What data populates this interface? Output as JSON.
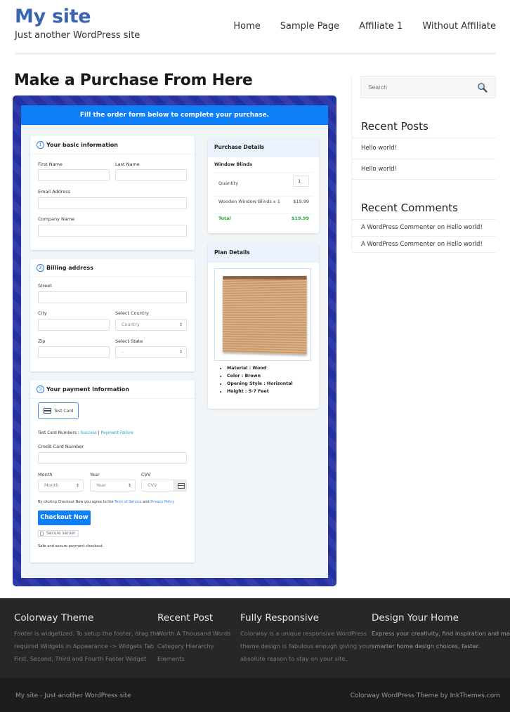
{
  "header": {
    "site_title": "My site",
    "tagline": "Just another WordPress site",
    "nav": [
      "Home",
      "Sample Page",
      "Affiliate 1",
      "Without Affiliate"
    ]
  },
  "page": {
    "title": "Make a Purchase From Here"
  },
  "form": {
    "banner": "Fill the order form below to complete your purchase.",
    "basic": {
      "step": "1",
      "title": "Your basic information",
      "first_name_label": "First Name",
      "last_name_label": "Last Name",
      "email_label": "Email Address",
      "company_label": "Company Name"
    },
    "billing": {
      "step": "2",
      "title": "Billing address",
      "street_label": "Street",
      "city_label": "City",
      "country_label": "Select Country",
      "country_value": "Country",
      "zip_label": "Zip",
      "state_label": "Select State",
      "state_value": "-"
    },
    "payment": {
      "step": "3",
      "title": "Your payment information",
      "method_tab": "Test Card",
      "test_numbers_prefix": "Test Card Numbers : ",
      "success_link": "Success",
      "separator": " | ",
      "failure_link": "Payment Failure",
      "cc_label": "Credit Card Number",
      "month_label": "Month",
      "month_value": "Month",
      "year_label": "Year",
      "year_value": "Year",
      "cvv_label": "CVV",
      "cvv_placeholder": "CVV",
      "agree_prefix": "By clicking Checkout Now you agree to the ",
      "terms_link": "Term of Service",
      "agree_and": " and ",
      "privacy_link": "Privacy Policy",
      "checkout_button": "Checkout Now",
      "secure_badge": "Secure server",
      "secure_note": "Safe and secure payment checkout."
    },
    "purchase": {
      "title": "Purchase Details",
      "product": "Window Blinds",
      "quantity_label": "Quantity",
      "quantity_value": "1",
      "line_item": "Wooden Window Blinds x 1",
      "line_price": "$19.99",
      "total_label": "Total",
      "total_value": "$19.99"
    },
    "plan": {
      "title": "Plan Details",
      "features": [
        "Material : Wood",
        "Color : Brown",
        "Opening Style : Horizontal",
        "Height : 5-7 Feet"
      ]
    }
  },
  "sidebar": {
    "search_placeholder": "Search",
    "recent_posts_title": "Recent Posts",
    "recent_posts": [
      "Hello world!",
      "Hello world!"
    ],
    "recent_comments_title": "Recent Comments",
    "recent_comments": [
      "A WordPress Commenter on Hello world!",
      "A WordPress Commenter on Hello world!"
    ]
  },
  "footer": {
    "columns": [
      {
        "title": "Colorway Theme",
        "lines": [
          "Footer is widgetized. To setup the footer, drag the",
          "required Widgets in Appearance -> Widgets Tab",
          "First, Second, Third and Fourth Footer Widget"
        ]
      },
      {
        "title": "Recent Post",
        "lines": [
          "Worth A Thousand Words",
          "Category Hierarchy",
          "Elements"
        ]
      },
      {
        "title": "Fully Responsive",
        "lines": [
          "Colorway is a unique responsive WordPress",
          "theme design is fabulous enough giving your",
          "absolute reason to stay on your site."
        ]
      },
      {
        "title": "Design Your Home",
        "lines": [
          "Express your creativity, find inspiration and make",
          "smarter home design choices, faster."
        ]
      }
    ],
    "bottom_left": "My site - Just another WordPress site",
    "bottom_right": "Colorway WordPress Theme by InkThemes.com"
  },
  "colors": {
    "brand": "#3b64b4",
    "form_primary": "#0f7ff7",
    "total_green": "#28a745",
    "footer_bg": "#272727"
  }
}
